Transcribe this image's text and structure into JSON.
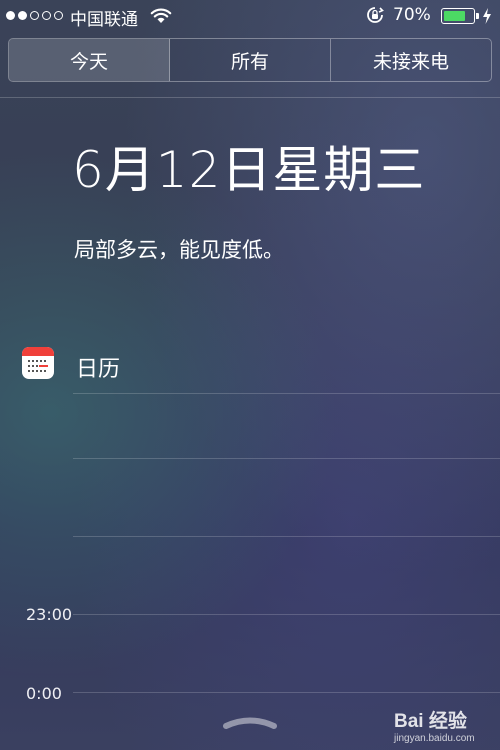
{
  "status_bar": {
    "signal_bars_total": 5,
    "signal_bars_filled": 2,
    "carrier": "中国联通",
    "battery_percent": "70%",
    "battery_level": 0.7,
    "battery_color": "#4cd964"
  },
  "tabs": [
    {
      "label": "今天",
      "selected": true
    },
    {
      "label": "所有",
      "selected": false
    },
    {
      "label": "未接来电",
      "selected": false
    }
  ],
  "today": {
    "date": "6月12日星期三",
    "weather_summary": "局部多云，能见度低。"
  },
  "calendar": {
    "title": "日历",
    "icon": "calendar-icon",
    "times": [
      "23:00",
      "0:00"
    ]
  },
  "watermark": {
    "logo_text": "Bai 经验",
    "url": "jingyan.baidu.com"
  }
}
